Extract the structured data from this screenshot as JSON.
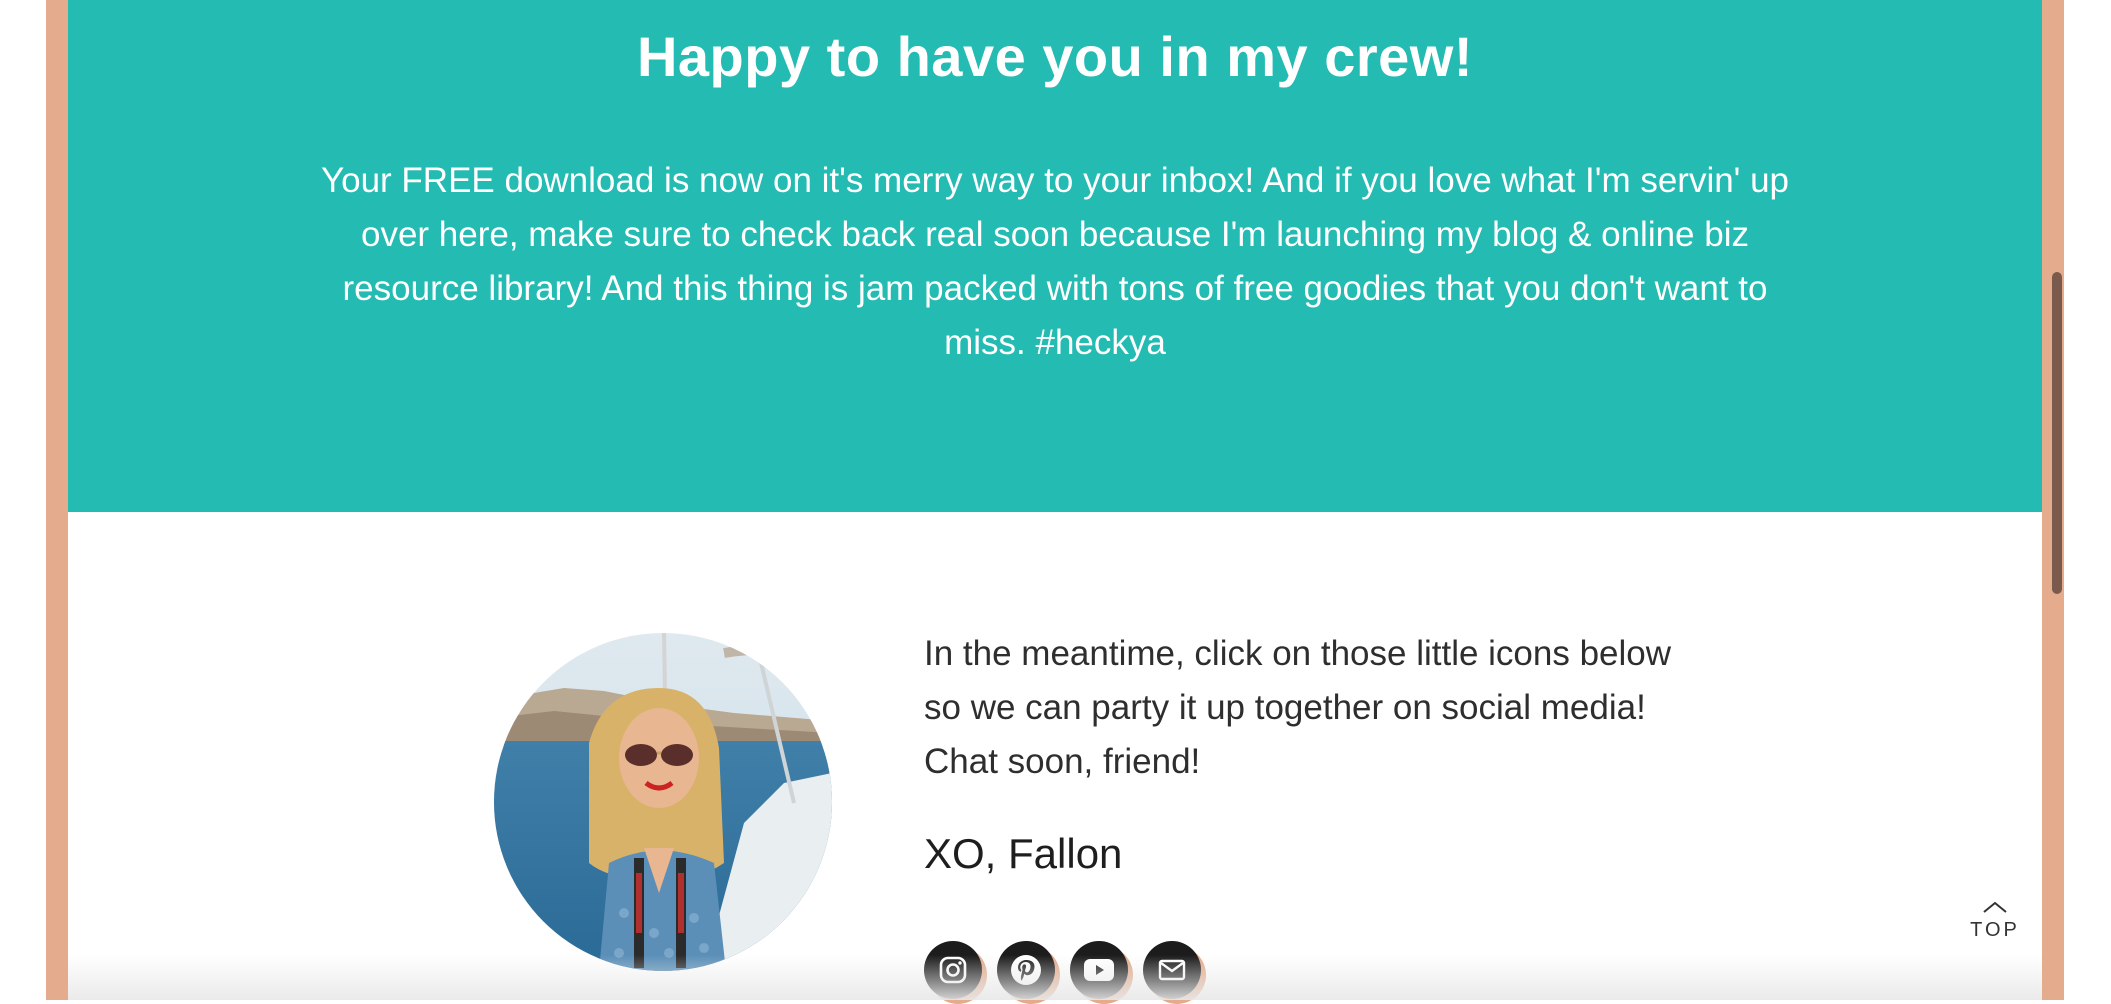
{
  "hero": {
    "title": "Happy to have you in my crew!",
    "body": "Your FREE download is now on it's merry way to your inbox! And if you love what I'm servin' up over here, make sure to check back real soon because I'm launching my blog & online biz resource library! And this thing is jam packed with tons of free goodies that you don't want to miss. #heckya"
  },
  "profile": {
    "intro": "In the meantime, click on those little icons below so we can party it up together on social media! Chat soon, friend!",
    "signoff": "XO, Fallon"
  },
  "social_icons": [
    "instagram-icon",
    "pinterest-icon",
    "youtube-icon",
    "email-icon"
  ],
  "back_to_top": {
    "label": "TOP"
  },
  "colors": {
    "hero_bg": "#24bbb3",
    "frame": "#e4ac8d",
    "icon_bg": "#1c1c1c"
  }
}
